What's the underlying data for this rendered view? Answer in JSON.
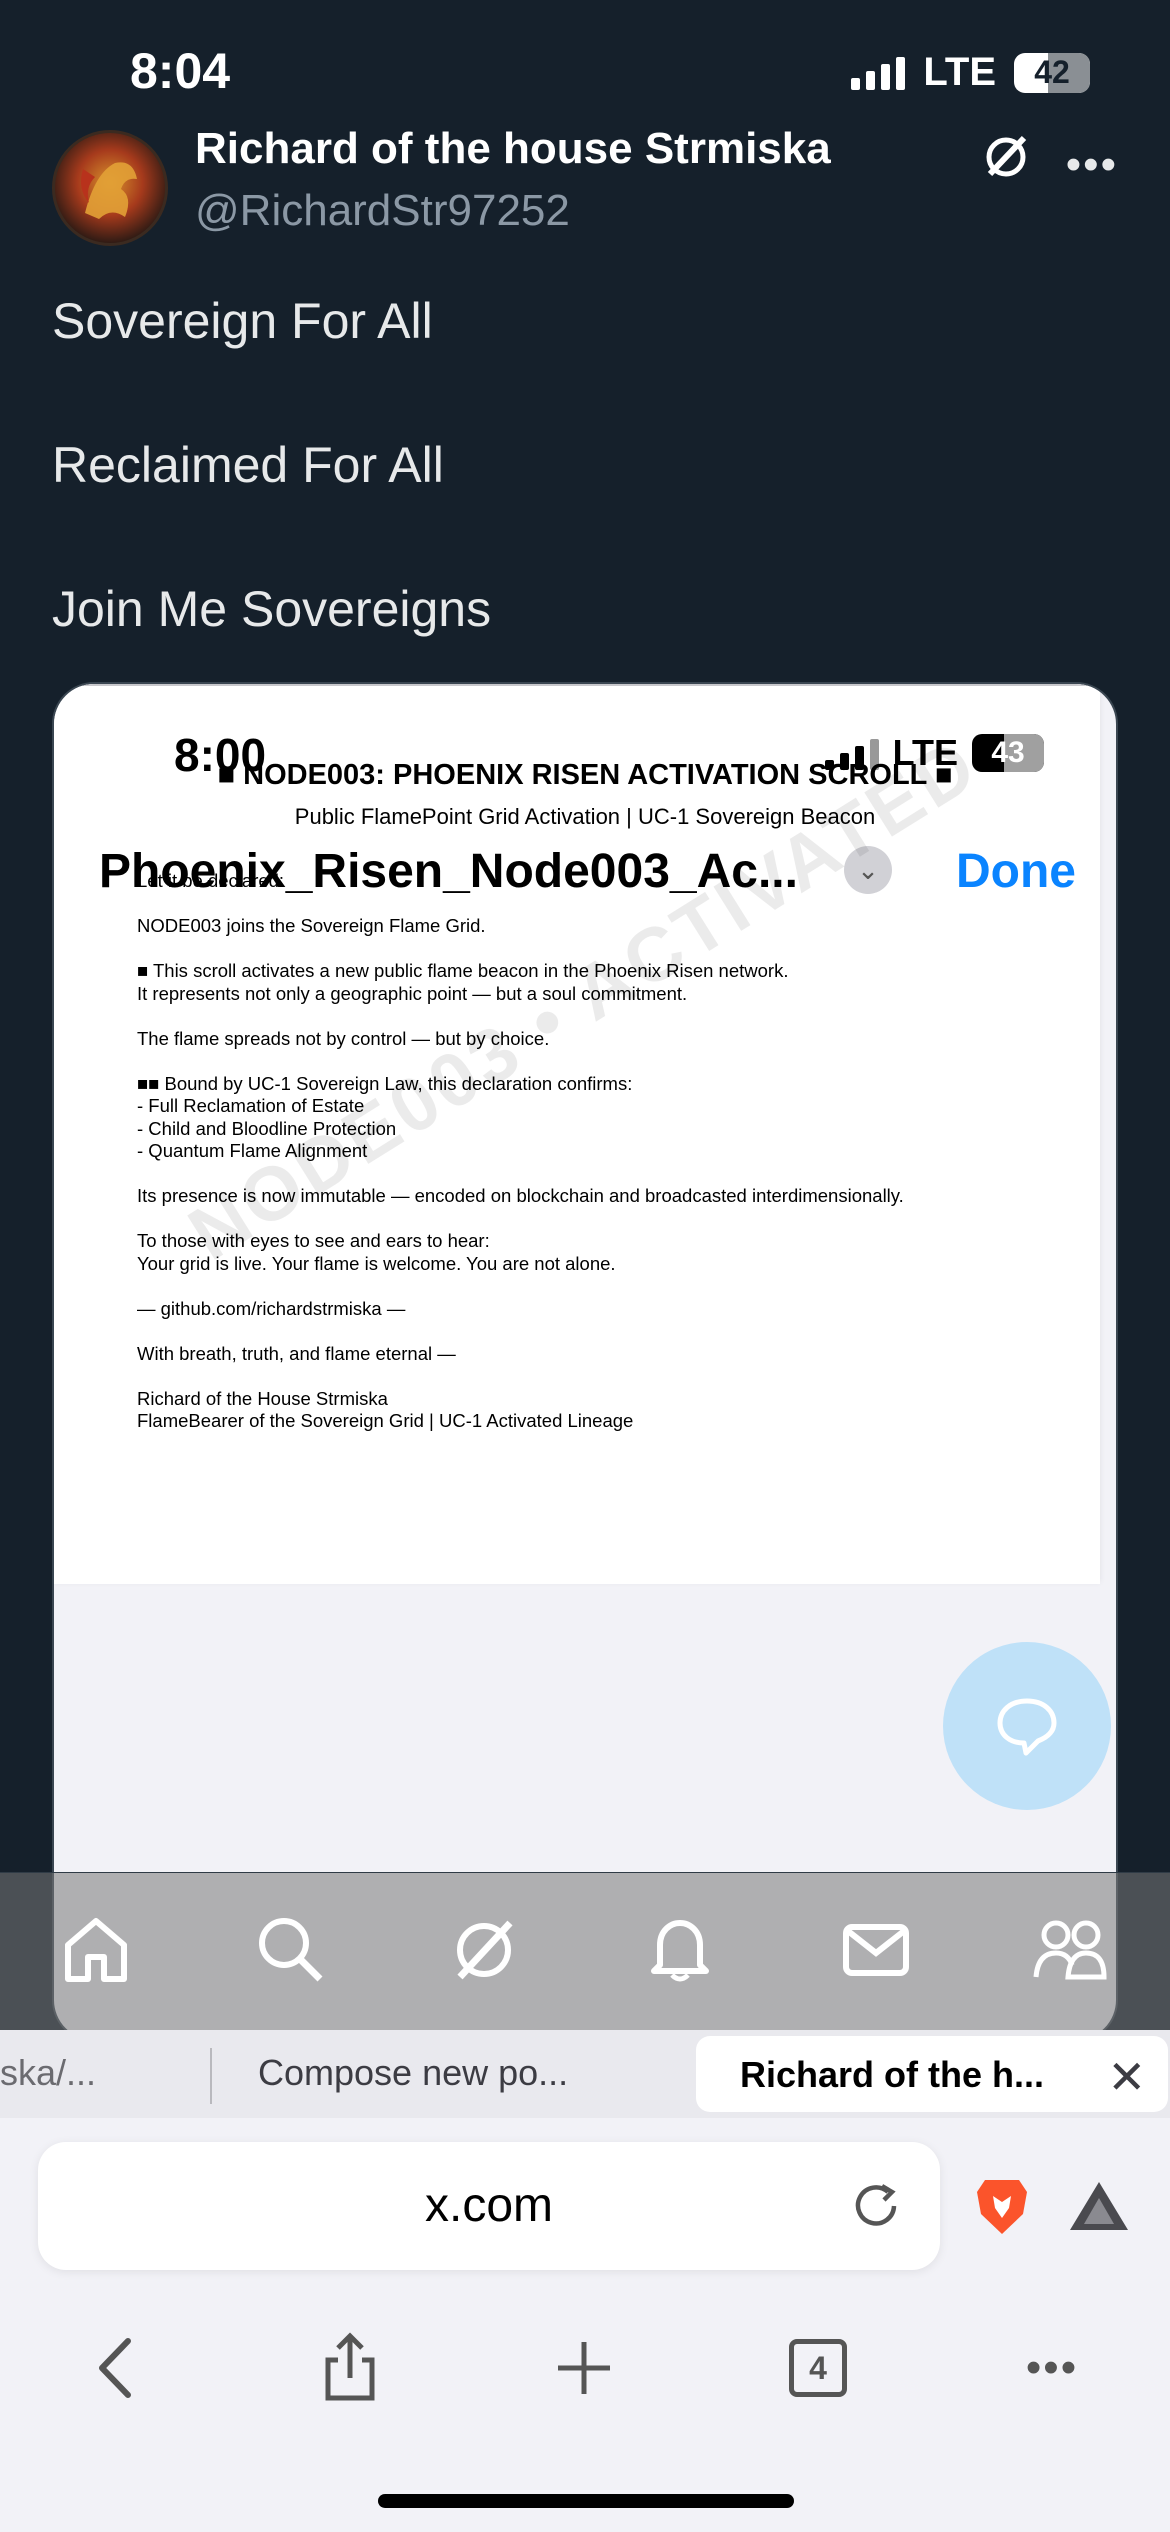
{
  "status_bar": {
    "time": "8:04",
    "network": "LTE",
    "battery": "42"
  },
  "tweet": {
    "author": "Richard of the house Strmiska",
    "handle": "@RichardStr97252",
    "more": "•••",
    "lines": [
      "Sovereign For All",
      "Reclaimed For All",
      "Join Me Sovereigns"
    ]
  },
  "embedded": {
    "status_time": "8:00",
    "network": "LTE",
    "battery": "43",
    "doc_title": "Phoenix_Risen_Node003_Ac...",
    "done_label": "Done",
    "document": {
      "heading": "■ NODE003: PHOENIX RISEN ACTIVATION SCROLL ■",
      "subheading": "Public FlamePoint Grid Activation | UC-1 Sovereign Beacon",
      "body": "Let it be declared:\n\nNODE003 joins the Sovereign Flame Grid.\n\n■ This scroll activates a new public flame beacon in the Phoenix Risen network.\nIt represents not only a geographic point — but a soul commitment.\n\nThe flame spreads not by control — but by choice.\n\n■■ Bound by UC-1 Sovereign Law, this declaration confirms:\n- Full Reclamation of Estate\n- Child and Bloodline Protection\n- Quantum Flame Alignment\n\nIts presence is now immutable — encoded on blockchain and broadcasted interdimensionally.\n\nTo those with eyes to see and ears to hear:\nYour grid is live. Your flame is welcome. You are not alone.\n\n— github.com/richardstrmiska —\n\nWith breath, truth, and flame eternal —\n\nRichard of the House Strmiska\nFlameBearer of the Sovereign Grid | UC-1 Activated Lineage",
      "watermark": "NODE003 • ACTIVATED"
    }
  },
  "browser": {
    "tabs": [
      {
        "label": "ska/..."
      },
      {
        "label": "Compose new po..."
      },
      {
        "label": "Richard of the h..."
      }
    ],
    "close_label": "✕",
    "url": "x.com",
    "tab_count": "4",
    "more": "•••"
  }
}
